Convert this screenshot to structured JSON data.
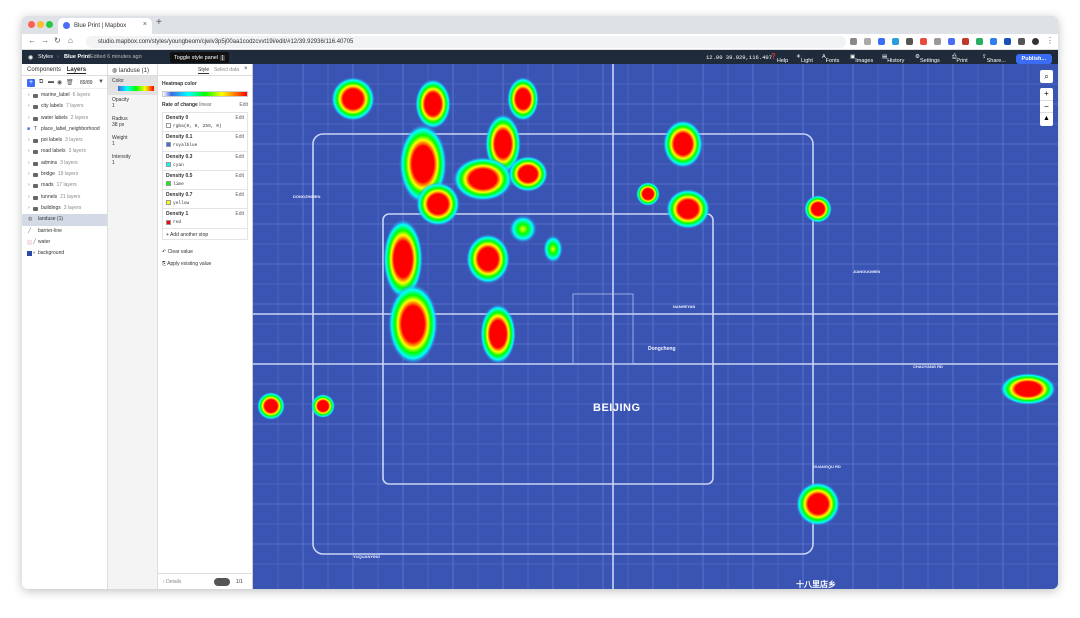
{
  "browser": {
    "tab_title": "Blue Print | Mapbox",
    "url": "studio.mapbox.com/styles/youngbeom/cjwiv3p5j00aa1codzcvvt19i/edit/#12/39.92936/116.40705"
  },
  "header": {
    "styles_label": "Styles",
    "style_name": "Blue Print",
    "edited": "Edited 6 minutes ago",
    "coords": "12.00 39.929,116.407",
    "menu": [
      "Help",
      "Light",
      "Fonts",
      "Images",
      "History",
      "Settings",
      "Print",
      "Share..."
    ],
    "publish": "Publish...",
    "tooltip": "Toggle style panel",
    "tooltip_key": "["
  },
  "left_panel": {
    "tabs": [
      "Components",
      "Layers"
    ],
    "count": "89/89",
    "layers": [
      {
        "name": "marine_label",
        "count": "6 layers",
        "type": "group"
      },
      {
        "name": "city labels",
        "count": "7 layers",
        "type": "group"
      },
      {
        "name": "water labels",
        "count": "2 layers",
        "type": "group"
      },
      {
        "name": "place_label_neighborhood",
        "count": "",
        "type": "symbol"
      },
      {
        "name": "poi labels",
        "count": "3 layers",
        "type": "group"
      },
      {
        "name": "road labels",
        "count": "3 layers",
        "type": "group"
      },
      {
        "name": "admins",
        "count": "3 layers",
        "type": "group"
      },
      {
        "name": "bridge",
        "count": "19 layers",
        "type": "group"
      },
      {
        "name": "roads",
        "count": "17 layers",
        "type": "group"
      },
      {
        "name": "tunnels",
        "count": "21 layers",
        "type": "group"
      },
      {
        "name": "buildings",
        "count": "3 layers",
        "type": "group"
      },
      {
        "name": "landuse (1)",
        "count": "",
        "type": "heatmap"
      },
      {
        "name": "barrier-line",
        "count": "",
        "type": "line"
      },
      {
        "name": "water",
        "count": "",
        "type": "fill"
      },
      {
        "name": "background",
        "count": "",
        "type": "background"
      }
    ]
  },
  "mid_panel": {
    "props": [
      {
        "label": "Color",
        "value": ""
      },
      {
        "label": "Opacity",
        "value": "1"
      },
      {
        "label": "Radius",
        "value": "38 px"
      },
      {
        "label": "Weight",
        "value": "1"
      },
      {
        "label": "Intensity",
        "value": "1"
      }
    ]
  },
  "right_panel": {
    "title": "landuse (1)",
    "tabs": [
      "Style",
      "Select data"
    ],
    "heading": "Heatmap color",
    "rate_label": "Rate of change",
    "rate_value": "linear",
    "edit": "Edit",
    "stops": [
      {
        "label": "Density 0",
        "value": "rgba(0, 0, 255, 0)",
        "color": "#ffffff"
      },
      {
        "label": "Density 0.1",
        "value": "royalblue",
        "color": "#4169e1"
      },
      {
        "label": "Density 0.3",
        "value": "cyan",
        "color": "#00ffff"
      },
      {
        "label": "Density 0.5",
        "value": "lime",
        "color": "#00ff00"
      },
      {
        "label": "Density 0.7",
        "value": "yellow",
        "color": "#ffff00"
      },
      {
        "label": "Density 1",
        "value": "red",
        "color": "#ff0000"
      }
    ],
    "add_stop": "Add another stop",
    "clear_value": "Clear value",
    "apply_existing": "Apply existing value",
    "details": "Details",
    "page": "1/1"
  },
  "map": {
    "city_label": "BEIJING",
    "district_labels": [
      "Dongcheng",
      "十八里店乡"
    ],
    "bg_color": "#3a54b4"
  }
}
